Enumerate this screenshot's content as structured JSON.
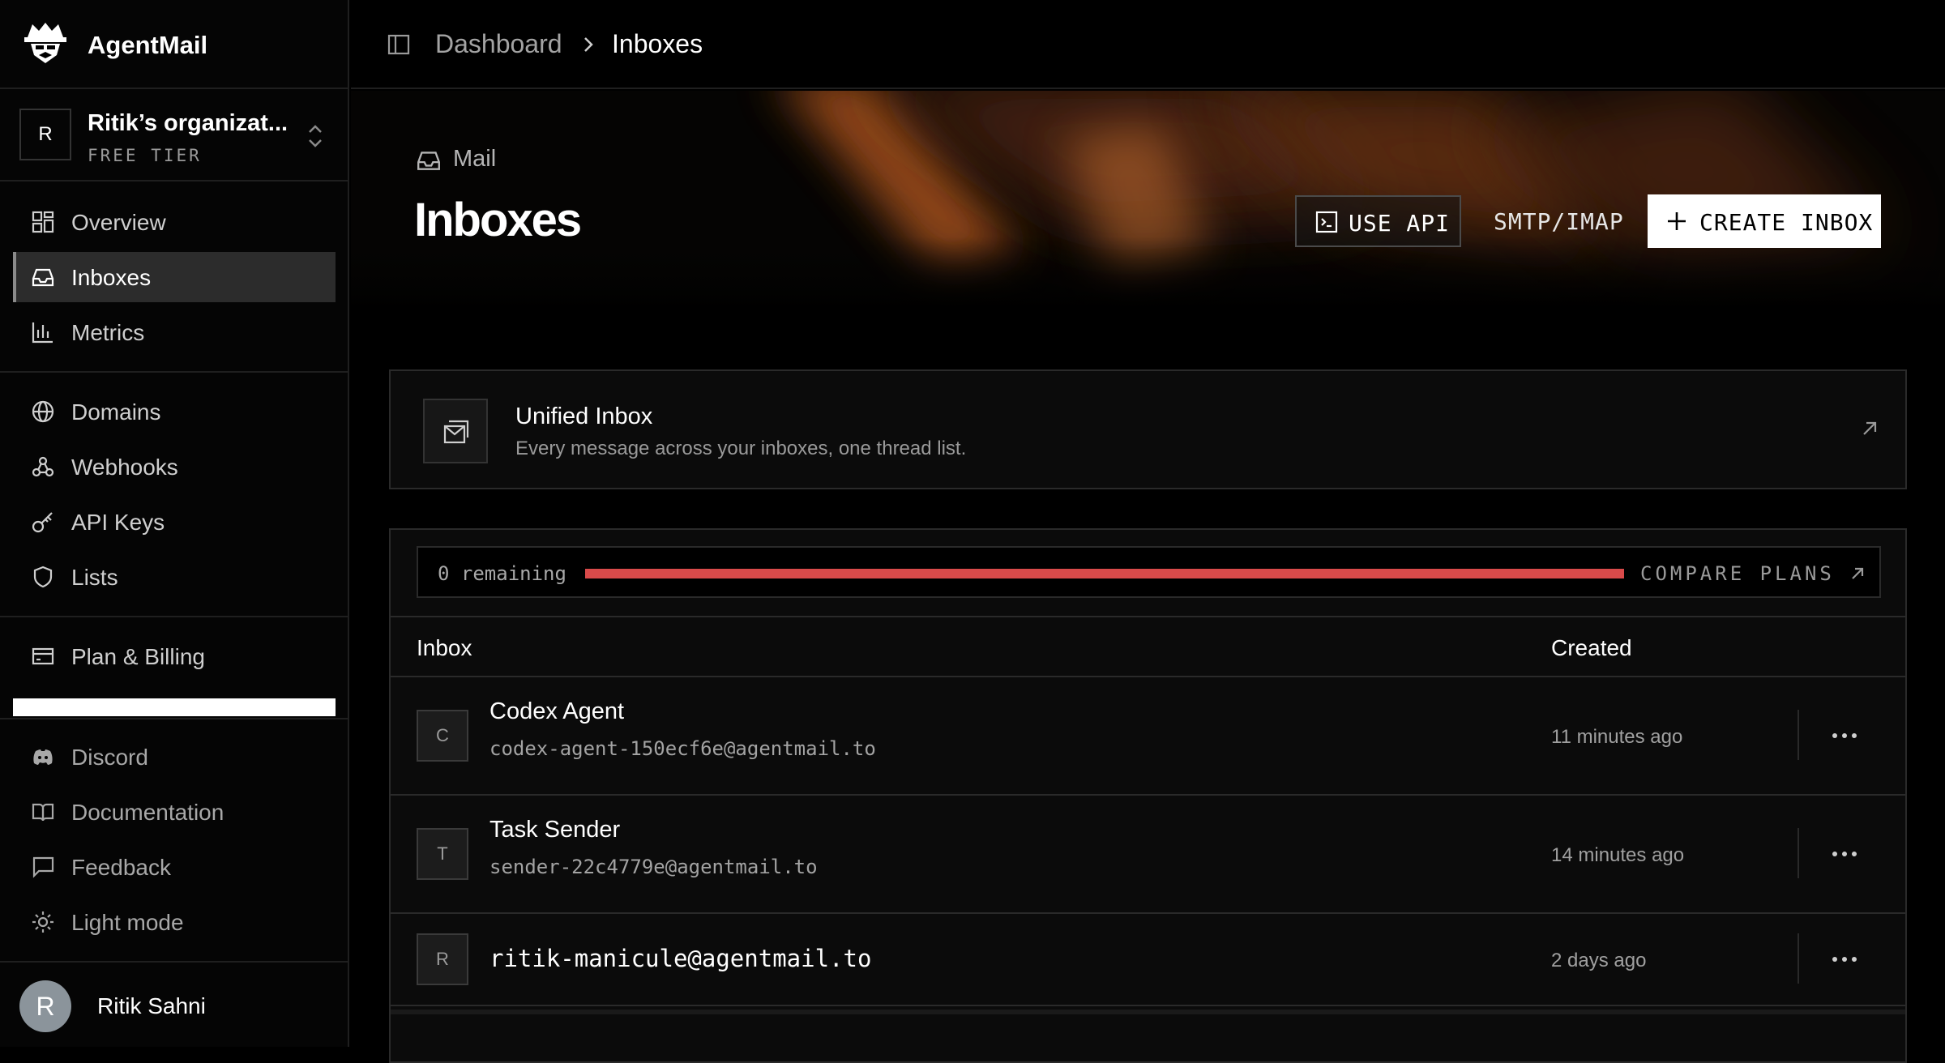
{
  "app": {
    "name": "AgentMail"
  },
  "org": {
    "avatar_letter": "R",
    "name": "Ritik’s organizat...",
    "tier": "FREE TIER"
  },
  "nav": {
    "overview": "Overview",
    "inboxes": "Inboxes",
    "metrics": "Metrics",
    "domains": "Domains",
    "webhooks": "Webhooks",
    "api_keys": "API Keys",
    "lists": "Lists",
    "plan_billing": "Plan & Billing",
    "discord": "Discord",
    "documentation": "Documentation",
    "feedback": "Feedback",
    "light_mode": "Light mode"
  },
  "user": {
    "avatar_letter": "R",
    "name": "Ritik Sahni"
  },
  "breadcrumb": {
    "parent": "Dashboard",
    "current": "Inboxes"
  },
  "header": {
    "section": "Mail",
    "title": "Inboxes",
    "use_api": "USE API",
    "smtp_imap": "SMTP/IMAP",
    "create_inbox": "CREATE INBOX"
  },
  "unified_inbox": {
    "title": "Unified Inbox",
    "subtitle": "Every message across your inboxes, one thread list."
  },
  "quota": {
    "text": "0 remaining",
    "used_fraction": 1.0,
    "compare_plans": "COMPARE PLANS"
  },
  "table": {
    "col_inbox": "Inbox",
    "col_created": "Created",
    "rows": [
      {
        "avatar": "C",
        "name": "Codex Agent",
        "email": "codex-agent-150ecf6e@agentmail.to",
        "created": "11 minutes ago"
      },
      {
        "avatar": "T",
        "name": "Task Sender",
        "email": "sender-22c4779e@agentmail.to",
        "created": "14 minutes ago"
      },
      {
        "avatar": "R",
        "name": "",
        "email": "ritik-manicule@agentmail.to",
        "created": "2 days ago"
      }
    ]
  },
  "colors": {
    "accent_fill": "#d94a4a",
    "background": "#000000",
    "button_primary": "#ffffff"
  }
}
